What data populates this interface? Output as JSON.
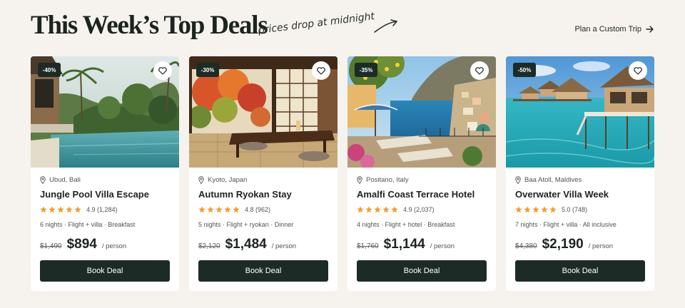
{
  "header": {
    "title": "This Week’s Top Deals",
    "tagline": "prices drop at midnight",
    "custom_trip_link": "Plan a Custom Trip"
  },
  "colors": {
    "background": "#f6f3ee",
    "button": "#1d2b26",
    "star": "#f0a030",
    "card": "#ffffff"
  },
  "icons": {
    "wishlist": "heart-icon",
    "location": "pin-icon",
    "rating": "star-icon",
    "link": "arrow-right-icon"
  },
  "deals": [
    {
      "badge": "-40%",
      "location": "Ubud, Bali",
      "name": "Jungle Pool Villa Escape",
      "rating": "4.9 (1,284)",
      "stars": 5,
      "details": "6 nights · Flight + villa · Breakfast",
      "old_price": "$1,490",
      "price": "$894",
      "per": "/ person",
      "cta": "Book Deal"
    },
    {
      "badge": "-30%",
      "location": "Kyoto, Japan",
      "name": "Autumn Ryokan Stay",
      "rating": "4.8 (962)",
      "stars": 5,
      "details": "5 nights · Flight + ryokan · Dinner",
      "old_price": "$2,120",
      "price": "$1,484",
      "per": "/ person",
      "cta": "Book Deal"
    },
    {
      "badge": "-35%",
      "location": "Positano, Italy",
      "name": "Amalfi Coast Terrace Hotel",
      "rating": "4.9 (2,037)",
      "stars": 5,
      "details": "4 nights · Flight + hotel · Breakfast",
      "old_price": "$1,760",
      "price": "$1,144",
      "per": "/ person",
      "cta": "Book Deal"
    },
    {
      "badge": "-50%",
      "location": "Baa Atoll, Maldives",
      "name": "Overwater Villa Week",
      "rating": "5.0 (748)",
      "stars": 5,
      "details": "7 nights · Flight + villa · All inclusive",
      "old_price": "$4,380",
      "price": "$2,190",
      "per": "/ person",
      "cta": "Book Deal"
    }
  ]
}
